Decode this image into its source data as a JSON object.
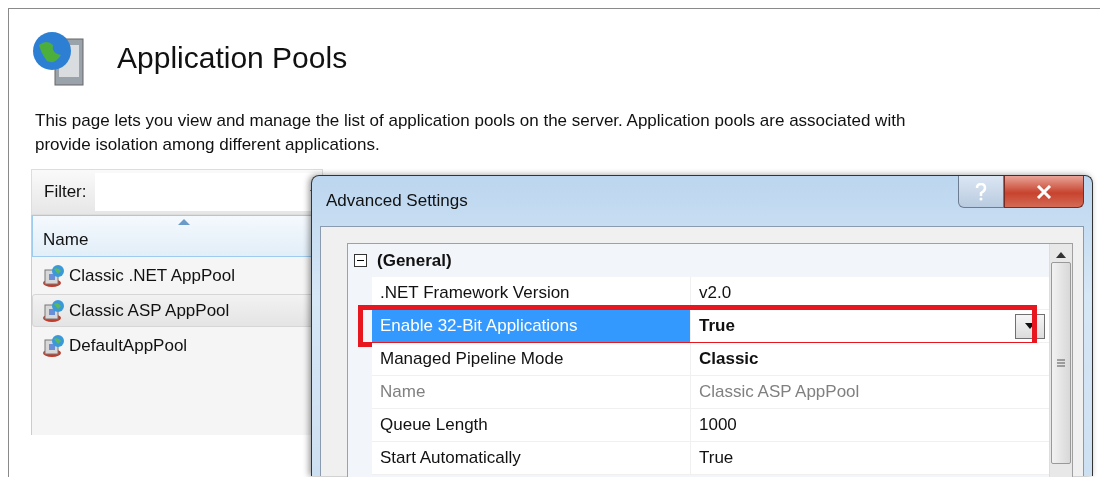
{
  "page": {
    "title": "Application Pools",
    "description": "This page lets you view and manage the list of application pools on the server. Application pools are associated with",
    "description_2": "provide isolation among different applications."
  },
  "filter": {
    "label": "Filter:"
  },
  "table": {
    "columns": [
      "Name"
    ],
    "rows": [
      {
        "name": "Classic .NET AppPool",
        "selected": false
      },
      {
        "name": "Classic ASP AppPool",
        "selected": true
      },
      {
        "name": "DefaultAppPool",
        "selected": false
      }
    ]
  },
  "dialog": {
    "title": "Advanced Settings",
    "groups": [
      {
        "name": "(General)",
        "expanded": true,
        "properties": [
          {
            "name": ".NET Framework Version",
            "value": "v2.0",
            "modified": false,
            "disabled": false,
            "selected": false,
            "highlighted": false
          },
          {
            "name": "Enable 32-Bit Applications",
            "value": "True",
            "modified": true,
            "disabled": false,
            "selected": true,
            "highlighted": true
          },
          {
            "name": "Managed Pipeline Mode",
            "value": "Classic",
            "modified": true,
            "disabled": false,
            "selected": false,
            "highlighted": false
          },
          {
            "name": "Name",
            "value": "Classic ASP AppPool",
            "modified": false,
            "disabled": true,
            "selected": false,
            "highlighted": false
          },
          {
            "name": "Queue Length",
            "value": "1000",
            "modified": false,
            "disabled": false,
            "selected": false,
            "highlighted": false
          },
          {
            "name": "Start Automatically",
            "value": "True",
            "modified": false,
            "disabled": false,
            "selected": false,
            "highlighted": false
          }
        ]
      }
    ]
  }
}
